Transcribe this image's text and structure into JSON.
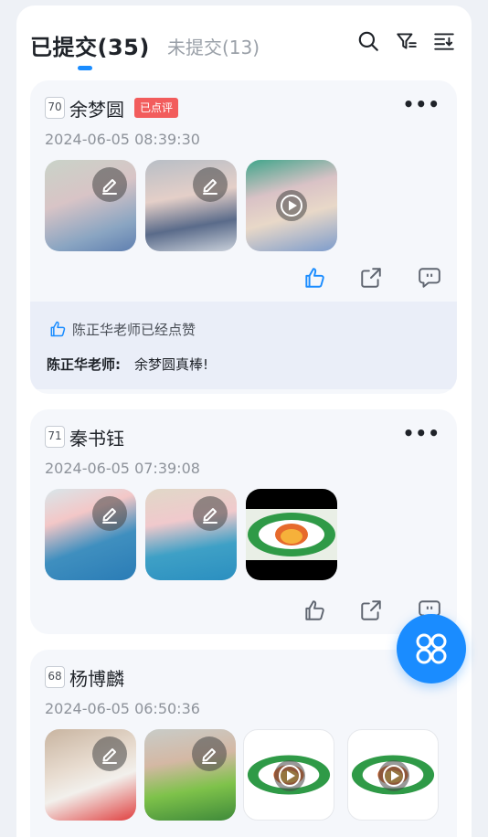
{
  "header": {
    "tab_submitted": "已提交(35)",
    "tab_unsubmitted": "未提交(13)",
    "icons": [
      "search-icon",
      "filter-icon",
      "sort-icon"
    ]
  },
  "colors": {
    "accent": "#1a8cff",
    "badge": "#f25c5c",
    "card_bg": "#f5f7fb",
    "comment_bg": "#eaeef8"
  },
  "submissions": [
    {
      "seq": "70",
      "name": "余梦圆",
      "badge": "已点评",
      "time": "2024-06-05 08:39:30",
      "liked": true,
      "like_note": "陈正华老师已经点赞",
      "comment_author": "陈正华老师:",
      "comment_text": "余梦圆真棒!"
    },
    {
      "seq": "71",
      "name": "秦书钰",
      "time": "2024-06-05 07:39:08",
      "liked": false
    },
    {
      "seq": "68",
      "name": "杨博麟",
      "time": "2024-06-05 06:50:36",
      "liked": false
    }
  ]
}
